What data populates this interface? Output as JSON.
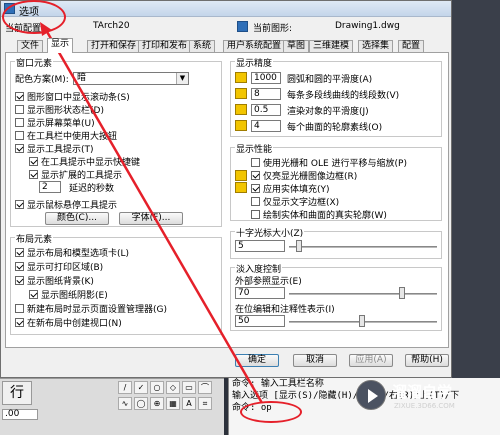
{
  "window": {
    "title": "选项"
  },
  "profile": {
    "current_config_label": "当前配置",
    "current_config_value": "TArch20",
    "current_drawing_label": "当前图形:",
    "current_drawing_value": "Drawing1.dwg"
  },
  "tabs": [
    "文件",
    "显示",
    "打开和保存",
    "打印和发布",
    "系统",
    "用户系统配置",
    "草图",
    "三维建模",
    "选择集",
    "配置"
  ],
  "active_tab": "显示",
  "window_elements": {
    "group_label": "窗口元素",
    "color_scheme_label": "配色方案(M):",
    "color_scheme_value": "暗",
    "checkboxes": [
      {
        "label": "图形窗口中显示滚动条(S)",
        "checked": true
      },
      {
        "label": "显示图形状态栏(D)",
        "checked": false
      },
      {
        "label": "显示屏幕菜单(U)",
        "checked": false
      },
      {
        "label": "在工具栏中使用大按钮",
        "checked": false
      },
      {
        "label": "显示工具提示(T)",
        "checked": true
      },
      {
        "label": "在工具提示中显示快捷键",
        "checked": true
      },
      {
        "label": "显示扩展的工具提示",
        "checked": true
      }
    ],
    "delay_value": "2",
    "delay_label": "延迟的秒数",
    "rollover_label": "显示鼠标悬停工具提示",
    "rollover_checked": true,
    "colors_button": "颜色(C)...",
    "fonts_button": "字体(F)..."
  },
  "layout_elements": {
    "group_label": "布局元素",
    "checkboxes": [
      {
        "label": "显示布局和模型选项卡(L)",
        "checked": true
      },
      {
        "label": "显示可打印区域(B)",
        "checked": true
      },
      {
        "label": "显示图纸背景(K)",
        "checked": true
      },
      {
        "label": "显示图纸阴影(E)",
        "checked": true
      },
      {
        "label": "新建布局时显示页面设置管理器(G)",
        "checked": false
      },
      {
        "label": "在新布局中创建视口(N)",
        "checked": true
      }
    ]
  },
  "display_resolution": {
    "group_label": "显示精度",
    "rows": [
      {
        "value": "1000",
        "label": "圆弧和圆的平滑度(A)"
      },
      {
        "value": "8",
        "label": "每条多段线曲线的线段数(V)"
      },
      {
        "value": "0.5",
        "label": "渲染对象的平滑度(J)"
      },
      {
        "value": "4",
        "label": "每个曲面的轮廓素线(O)"
      }
    ]
  },
  "display_performance": {
    "group_label": "显示性能",
    "checkboxes": [
      {
        "label": "使用光栅和 OLE 进行平移与缩放(P)",
        "checked": false
      },
      {
        "label": "仅亮显光栅图像边框(R)",
        "checked": true
      },
      {
        "label": "应用实体填充(Y)",
        "checked": true
      },
      {
        "label": "仅显示文字边框(X)",
        "checked": false
      },
      {
        "label": "绘制实体和曲面的真实轮廓(W)",
        "checked": false
      }
    ]
  },
  "crosshair": {
    "group_label": "十字光标大小(Z)",
    "value": "5",
    "level_percent": 5
  },
  "fade_control": {
    "group_label": "淡入度控制",
    "xref_label": "外部参照显示(E)",
    "xref_value": "70",
    "inplace_label": "在位编辑和注释性表示(I)",
    "inplace_value": "50"
  },
  "buttons": {
    "ok": "确定",
    "cancel": "取消",
    "apply": "应用(A)",
    "help": "帮助(H)"
  },
  "toolbar": {
    "left_text": "行",
    "left_value": ".00",
    "tool_glyphs": [
      "/",
      "✓",
      "○",
      "◇",
      "▭",
      "⌒",
      "∿",
      "◯",
      "⊕",
      "▦",
      "A",
      "⌗"
    ]
  },
  "command_line": {
    "lines": [
      "命令: 输入工具栏名称",
      "输入选项 [显示(S)/隐藏(H)/左(L)/右(R)/上(T)/下",
      "命令: op"
    ]
  },
  "watermark": {
    "title": "溜溜自学",
    "url": "ZIXUE.3D66.COM"
  },
  "colors": {
    "annotation": "#e5202a",
    "titlebar": "#dfe9f5",
    "panel": "#ffffff"
  }
}
